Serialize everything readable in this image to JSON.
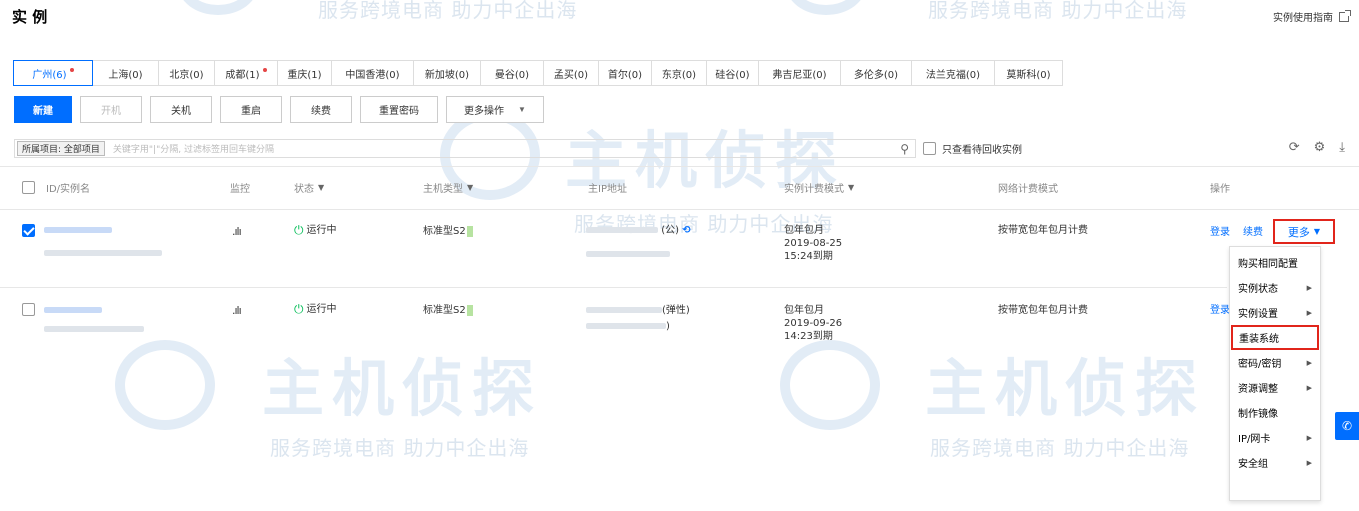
{
  "page": {
    "title": "实 例",
    "guide_link": "实例使用指南",
    "watermark_brand": "主机侦探",
    "watermark_slogan": "服务跨境电商 助力中企出海"
  },
  "regions": [
    {
      "label": "广州(6)",
      "active": true,
      "dot": true
    },
    {
      "label": "上海(0)"
    },
    {
      "label": "北京(0)"
    },
    {
      "label": "成都(1)",
      "dot": true
    },
    {
      "label": "重庆(1)"
    },
    {
      "label": "中国香港(0)"
    },
    {
      "label": "新加坡(0)"
    },
    {
      "label": "曼谷(0)"
    },
    {
      "label": "孟买(0)"
    },
    {
      "label": "首尔(0)"
    },
    {
      "label": "东京(0)"
    },
    {
      "label": "硅谷(0)"
    },
    {
      "label": "弗吉尼亚(0)"
    },
    {
      "label": "多伦多(0)"
    },
    {
      "label": "法兰克福(0)"
    },
    {
      "label": "莫斯科(0)"
    }
  ],
  "toolbar": {
    "new_label": "新建",
    "start_label": "开机",
    "stop_label": "关机",
    "restart_label": "重启",
    "renew_label": "续费",
    "reset_pw_label": "重置密码",
    "more_ops_label": "更多操作"
  },
  "filter": {
    "tag": "所属项目: 全部项目",
    "placeholder": "关键字用\"|\"分隔, 过滤标签用回车键分隔",
    "recycle_label": "只查看待回收实例"
  },
  "columns": {
    "id_name": "ID/实例名",
    "monitor": "监控",
    "status": "状态",
    "type": "主机类型",
    "ip": "主IP地址",
    "billing": "实例计费模式",
    "net_billing": "网络计费模式",
    "ops": "操作"
  },
  "rows": [
    {
      "status": "运行中",
      "type": "标准型S2",
      "ip_suffix": "(公)",
      "billing_mode": "包年包月",
      "expiry_date": "2019-08-25",
      "expiry_time": "15:24到期",
      "net_billing": "按带宽包年包月计费",
      "login": "登录",
      "renew": "续费",
      "more": "更多"
    },
    {
      "status": "运行中",
      "type": "标准型S2",
      "ip_suffix": "(弹性)",
      "ip_suffix2": ")",
      "billing_mode": "包年包月",
      "expiry_date": "2019-09-26",
      "expiry_time": "14:23到期",
      "net_billing": "按带宽包年包月计费",
      "login": "登录"
    }
  ],
  "more_menu": [
    {
      "label": "购买相同配置",
      "sub": false
    },
    {
      "label": "实例状态",
      "sub": true
    },
    {
      "label": "实例设置",
      "sub": true
    },
    {
      "label": "重装系统",
      "sub": false,
      "highlighted": true
    },
    {
      "label": "密码/密钥",
      "sub": true
    },
    {
      "label": "资源调整",
      "sub": true
    },
    {
      "label": "制作镜像",
      "sub": false
    },
    {
      "label": "IP/网卡",
      "sub": true
    },
    {
      "label": "安全组",
      "sub": true
    }
  ],
  "colors": {
    "accent": "#006eff",
    "highlight": "#e1251b",
    "running": "#0abf5b"
  }
}
